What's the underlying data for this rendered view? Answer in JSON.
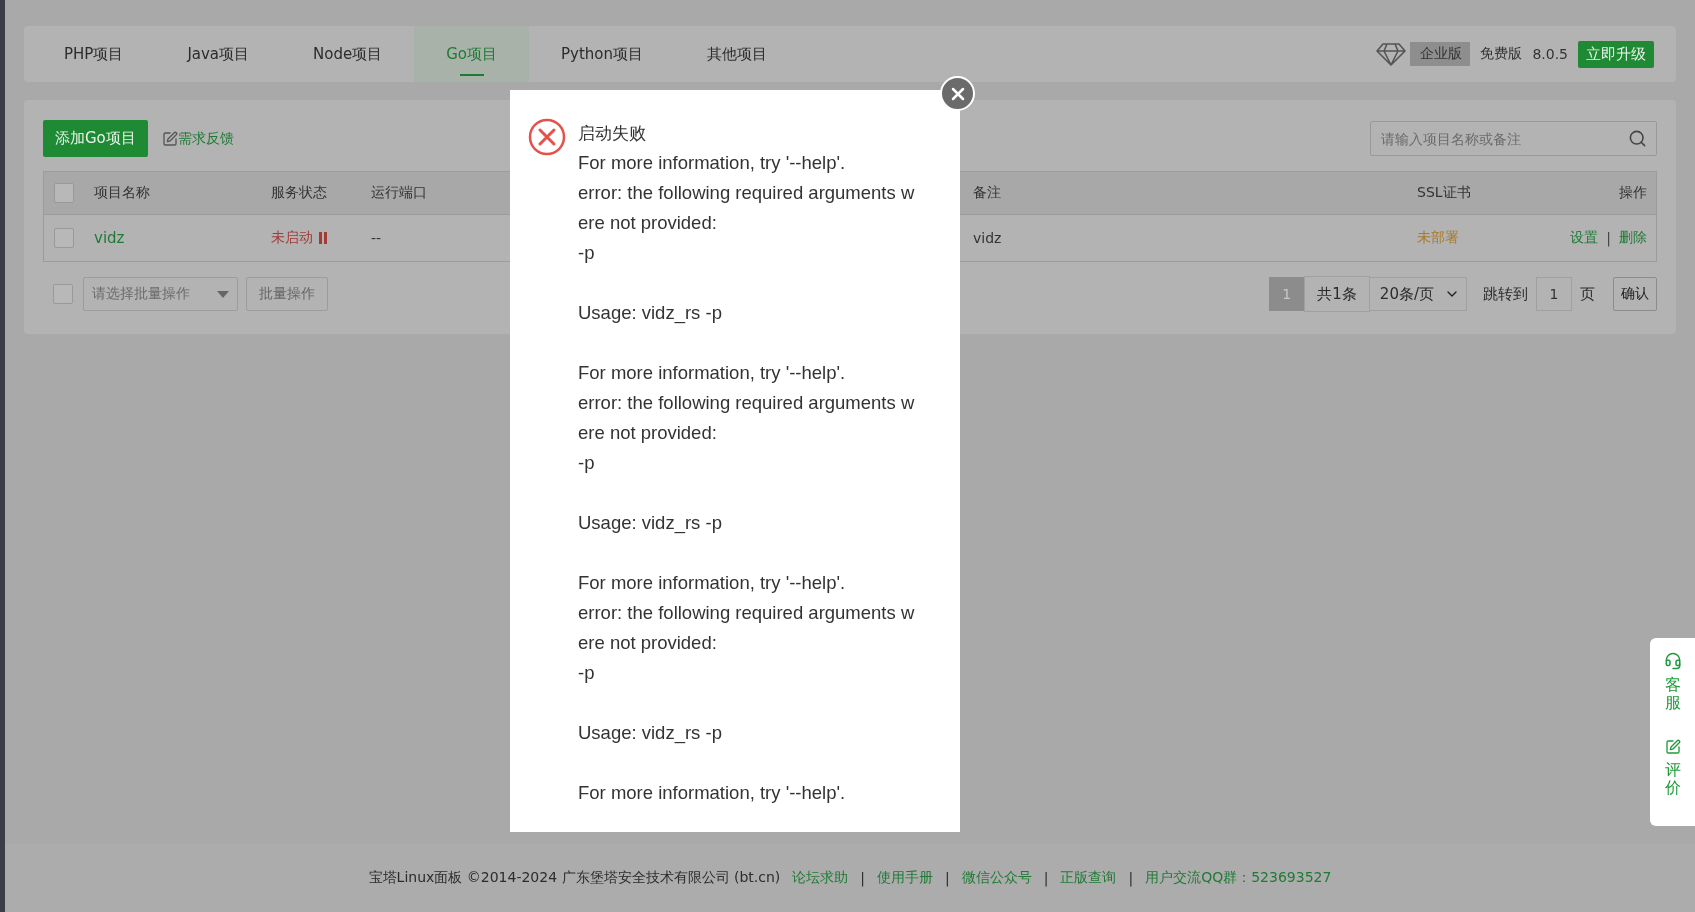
{
  "tabs": [
    {
      "label": "PHP项目",
      "selected": false
    },
    {
      "label": "Java项目",
      "selected": false
    },
    {
      "label": "Node项目",
      "selected": false
    },
    {
      "label": "Go项目",
      "selected": true
    },
    {
      "label": "Python项目",
      "selected": false
    },
    {
      "label": "其他项目",
      "selected": false
    }
  ],
  "edition": {
    "badge": "企业版",
    "plan": "免费版",
    "version": "8.0.5",
    "upgrade": "立即升级"
  },
  "toolbar": {
    "add_button": "添加Go项目",
    "feedback_link": "需求反馈",
    "search": {
      "placeholder": "请输入项目名称或备注"
    }
  },
  "table": {
    "header_checked": false,
    "columns": [
      "项目名称",
      "服务状态",
      "运行端口",
      "备注",
      "SSL证书",
      "操作"
    ],
    "rows": [
      {
        "checked": false,
        "name": "vidz",
        "status": "未启动",
        "running": false,
        "port": "--",
        "note": "vidz",
        "ssl": "未部署",
        "actions": [
          "设置",
          "删除"
        ],
        "separator": "|"
      }
    ]
  },
  "batch": {
    "checked": false,
    "select_placeholder": "请选择批量操作",
    "button": "批量操作"
  },
  "pagination": {
    "pages": [
      {
        "label": "1",
        "selected": true
      }
    ],
    "total": "共1条",
    "page_size": "20条/页",
    "jump_label": "跳转到",
    "jump_value": "1",
    "page_unit": "页",
    "confirm": "确认"
  },
  "dialog": {
    "title": "启动失败",
    "blocks": [
      "For more information, try '--help'.\nerror: the following required arguments w\nere not provided:\n-p",
      "Usage: vidz_rs -p",
      "For more information, try '--help'.\nerror: the following required arguments w\nere not provided:\n-p",
      "Usage: vidz_rs -p",
      "For more information, try '--help'.\nerror: the following required arguments w\nere not provided:\n-p",
      "Usage: vidz_rs -p",
      "For more information, try '--help'."
    ]
  },
  "footer": {
    "copyright": "宝塔Linux面板 ©2014-2024 广东堡塔安全技术有限公司 (bt.cn)",
    "separator": "|",
    "links": [
      "论坛求助",
      "使用手册",
      "微信公众号",
      "正版查询",
      "用户交流QQ群：523693527"
    ]
  },
  "side_widget": {
    "items": [
      {
        "kind": "headset",
        "label": "客服"
      },
      {
        "kind": "edit",
        "label": "评价"
      }
    ]
  }
}
